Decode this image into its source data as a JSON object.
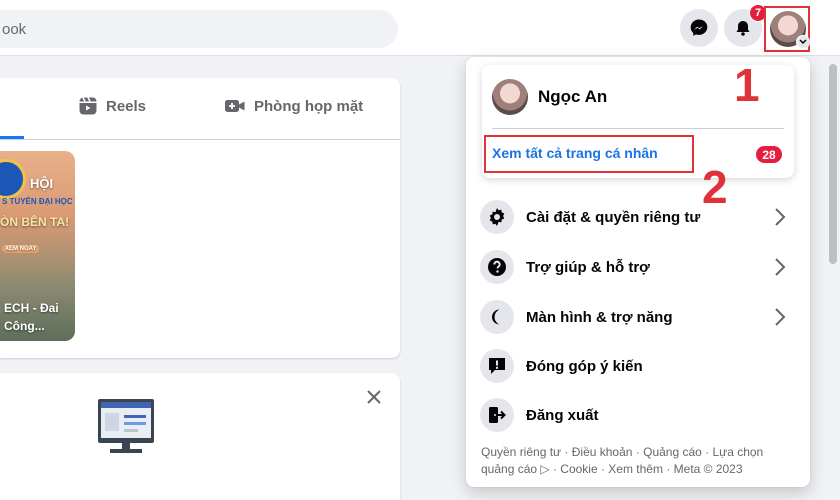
{
  "search": {
    "placeholder": "ook"
  },
  "header": {
    "notification_count": "7"
  },
  "feed": {
    "tabs": [
      {
        "label": "Reels"
      },
      {
        "label": "Phòng họp mặt"
      }
    ],
    "story": {
      "line1": "HỘI",
      "line2": "S TUYỂN ĐẠI HỌC",
      "line3": "ÒN BÊN TA!",
      "cta": "XEM NGAY",
      "caption1": "ECH - Đai",
      "caption2": "Công..."
    }
  },
  "dropdown": {
    "profile": {
      "name": "Ngọc An",
      "see_all": "Xem tất cả trang cá nhân",
      "count": "28"
    },
    "items": [
      {
        "label": "Cài đặt & quyền riêng tư",
        "icon": "gear-icon"
      },
      {
        "label": "Trợ giúp & hỗ trợ",
        "icon": "help-icon"
      },
      {
        "label": "Màn hình & trợ năng",
        "icon": "moon-icon"
      },
      {
        "label": "Đóng góp ý kiến",
        "icon": "feedback-icon"
      },
      {
        "label": "Đăng xuất",
        "icon": "logout-icon"
      }
    ],
    "footer": "Quyền riêng tư · Điều khoản · Quảng cáo · Lựa chọn quảng cáo ▷ · Cookie · Xem thêm · Meta © 2023"
  },
  "annotations": {
    "one": "1",
    "two": "2"
  },
  "colors": {
    "accent": "#1877f2",
    "highlight": "#e0323a",
    "badge": "#e41e3f"
  }
}
